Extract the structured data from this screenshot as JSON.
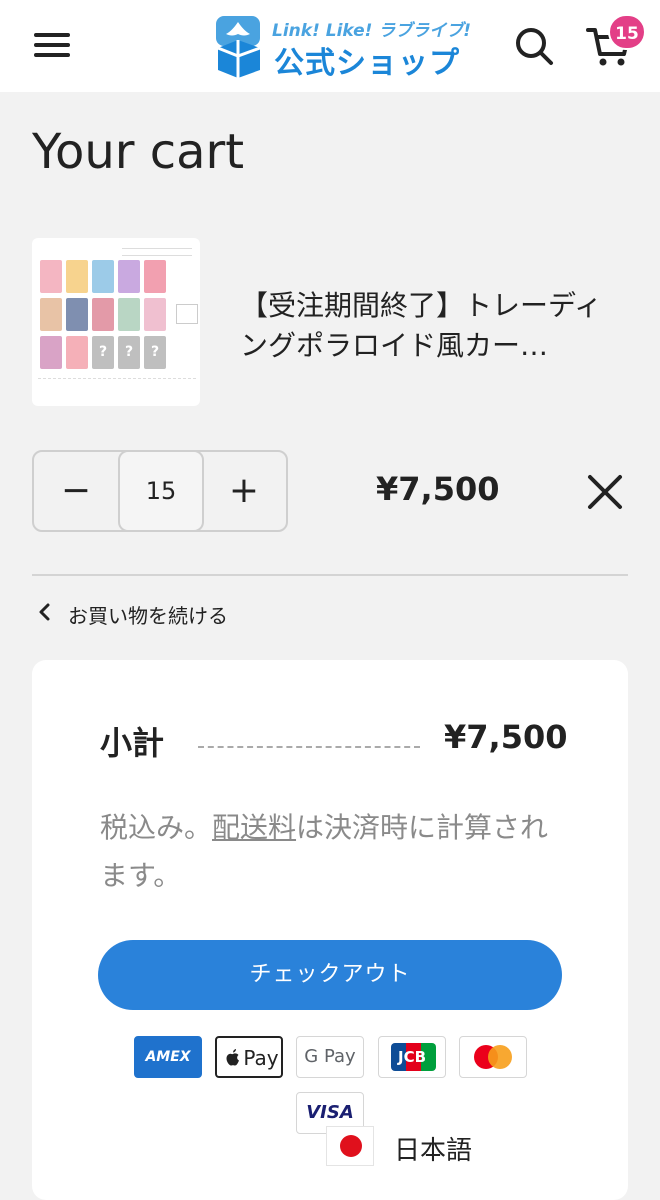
{
  "header": {
    "logo_line1": "Link! Like! ラブライブ!",
    "logo_line2": "公式ショップ",
    "cart_count": "15"
  },
  "page": {
    "title": "Your cart"
  },
  "cart_item": {
    "title": "【受注期間終了】トレーディングポラロイド風カー…",
    "quantity": "15",
    "minus_label": "−",
    "plus_label": "+",
    "line_price": "¥7,500",
    "thumb_placeholder": "?"
  },
  "continue_shopping": "お買い物を続ける",
  "summary": {
    "subtotal_label": "小計",
    "subtotal_value": "¥7,500",
    "tax_note_prefix": "税込み。",
    "tax_note_link": "配送料",
    "tax_note_suffix": "は決済時に計算されます。",
    "checkout_label": "チェックアウト"
  },
  "payment_methods": {
    "amex": "AMEX",
    "apple_pay": "Pay",
    "google_pay": "G Pay",
    "jcb": "JCB",
    "mastercard": "",
    "visa": "VISA"
  },
  "language": {
    "label": "日本語"
  },
  "colors": {
    "accent": "#2a82da",
    "badge": "#e33f87",
    "logo": "#1b86d8",
    "background": "#f2f2f2"
  }
}
